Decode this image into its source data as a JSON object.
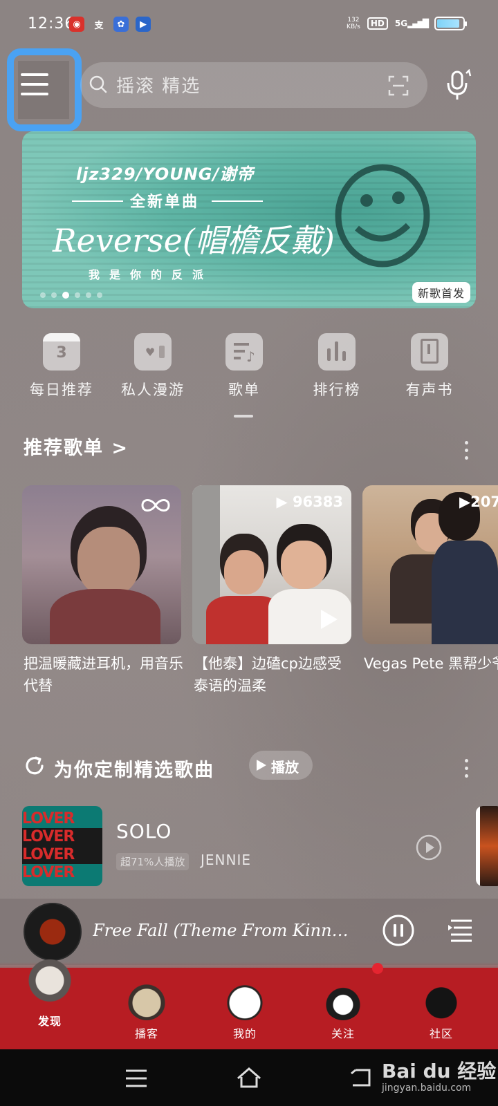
{
  "status_bar": {
    "time": "12:36",
    "net_speed": "132",
    "net_unit": "KB/s",
    "hd": "HD",
    "network": "5G",
    "app_icons": [
      "netease-music-icon",
      "alipay-icon",
      "baidu-icon",
      "baidu-video-icon"
    ],
    "battery_level": 0.9
  },
  "search": {
    "placeholder": "摇滚 精选"
  },
  "banner": {
    "line1": "ljz329/YOUNG/谢帝",
    "line2": "全新单曲",
    "line3": "Reverse(帽檐反戴)",
    "line4": "我是你的反派",
    "badge": "新歌首发",
    "page_count": 6,
    "active_page": 3
  },
  "categories": [
    {
      "label": "每日推荐",
      "icon": "calendar-icon",
      "day": "3"
    },
    {
      "label": "私人漫游",
      "icon": "radio-icon"
    },
    {
      "label": "歌单",
      "icon": "playlist-icon"
    },
    {
      "label": "排行榜",
      "icon": "chart-icon"
    },
    {
      "label": "有声书",
      "icon": "audiobook-icon"
    }
  ],
  "recommended": {
    "title": "推荐歌单 >",
    "playlists": [
      {
        "name": "把温暖藏进耳机，用音乐代替",
        "count": "",
        "icon": "infinity-icon"
      },
      {
        "name": "【他泰】边磕cp边感受泰语的温柔",
        "count": "96383"
      },
      {
        "name": "Vegas Pete 黑帮少爷上我",
        "count": "207"
      }
    ]
  },
  "daily": {
    "title": "为你定制精选歌曲",
    "play_label": "播放",
    "song": {
      "title": "SOLO",
      "tag": "超71%人播放",
      "artist": "JENNIE",
      "cover_text": "LOVER"
    }
  },
  "player": {
    "title": "Free Fall (Theme From KinnPorsch…"
  },
  "bottom_nav": [
    {
      "label": "发现",
      "active": true
    },
    {
      "label": "播客",
      "active": false
    },
    {
      "label": "我的",
      "active": false
    },
    {
      "label": "关注",
      "active": false
    },
    {
      "label": "社区",
      "active": false
    }
  ],
  "watermark": {
    "brand": "Bai du 经验",
    "url": "jingyan.baidu.com"
  },
  "colors": {
    "background": "#8f8786",
    "highlight_box": "#4aa2f3",
    "nav_red": "#b71d23",
    "banner_teal": "#5fb5a5",
    "notification_dot": "#e52530"
  }
}
